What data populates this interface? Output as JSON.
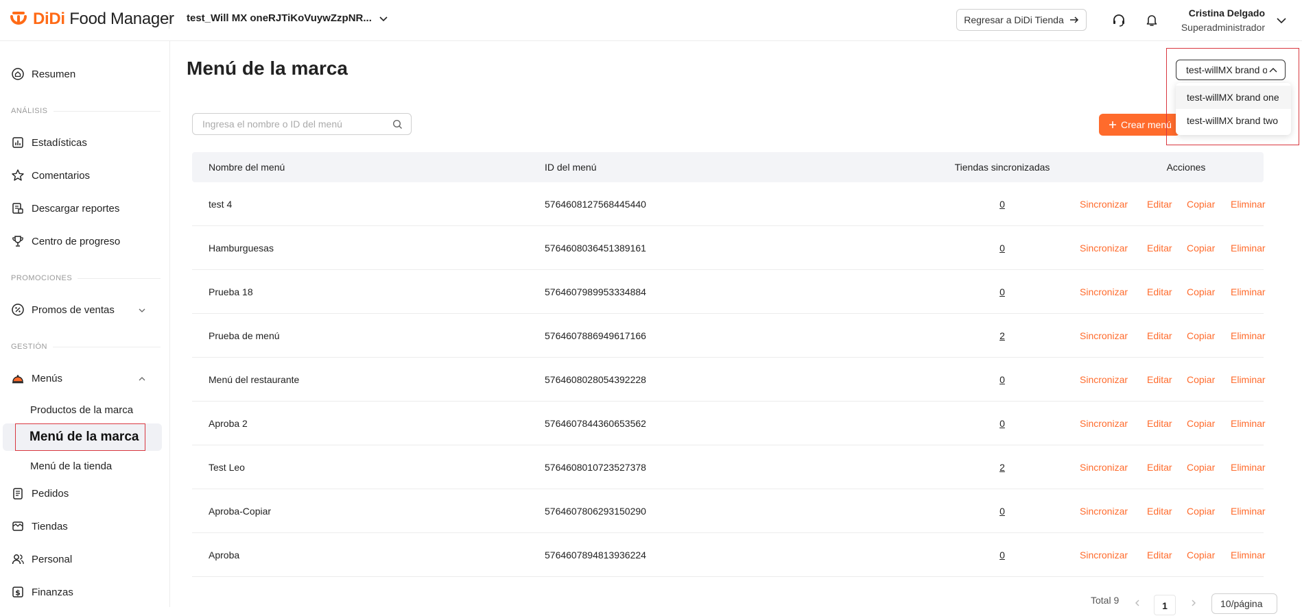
{
  "header": {
    "logo_brand": "DiDi",
    "logo_product": "Food Manager",
    "store_name": "test_Will MX oneRJTiKoVuywZzpNR...",
    "back_button_label": "Regresar a DiDi Tienda",
    "user_name": "Cristina Delgado",
    "user_role": "Superadministrador",
    "accent_color": "#ff6b2c"
  },
  "sidebar": {
    "resumen": "Resumen",
    "section_analisis": "ANÁLISIS",
    "estadisticas": "Estadísticas",
    "comentarios": "Comentarios",
    "descargar_reportes": "Descargar reportes",
    "centro_progreso": "Centro de progreso",
    "section_promociones": "PROMOCIONES",
    "promos_ventas": "Promos de ventas",
    "section_gestion": "GESTIÓN",
    "menus": "Menús",
    "productos_marca": "Productos de la marca",
    "menu_marca": "Menú de la marca",
    "menu_tienda": "Menú de la tienda",
    "pedidos": "Pedidos",
    "tiendas": "Tiendas",
    "personal": "Personal",
    "finanzas": "Finanzas"
  },
  "main": {
    "page_title": "Menú de la marca",
    "brand_select_value": "test-willMX brand one",
    "brand_options": [
      "test-willMX brand one",
      "test-willMX brand two"
    ],
    "search_placeholder": "Ingresa el nombre o ID del menú",
    "create_button_label": "Crear menú"
  },
  "table": {
    "columns": [
      "Nombre del menú",
      "ID del menú",
      "Tiendas sincronizadas",
      "Acciones"
    ],
    "action_labels": [
      "Sincronizar",
      "Editar",
      "Copiar",
      "Eliminar"
    ],
    "rows": [
      {
        "name": "test 4",
        "id": "5764608127568445440",
        "stores": "0"
      },
      {
        "name": "Hamburguesas",
        "id": "5764608036451389161",
        "stores": "0"
      },
      {
        "name": "Prueba 18",
        "id": "5764607989953334884",
        "stores": "0"
      },
      {
        "name": "Prueba de menú",
        "id": "5764607886949617166",
        "stores": "2"
      },
      {
        "name": "Menú del restaurante",
        "id": "5764608028054392228",
        "stores": "0"
      },
      {
        "name": "Aproba 2",
        "id": "5764607844360653562",
        "stores": "0"
      },
      {
        "name": "Test Leo",
        "id": "5764608010723527378",
        "stores": "2"
      },
      {
        "name": "Aproba-Copiar",
        "id": "5764607806293150290",
        "stores": "0"
      },
      {
        "name": "Aproba",
        "id": "5764607894813936224",
        "stores": "0"
      }
    ]
  },
  "pagination": {
    "total_label": "Total 9",
    "current_page": "1",
    "page_size": "10/página"
  }
}
